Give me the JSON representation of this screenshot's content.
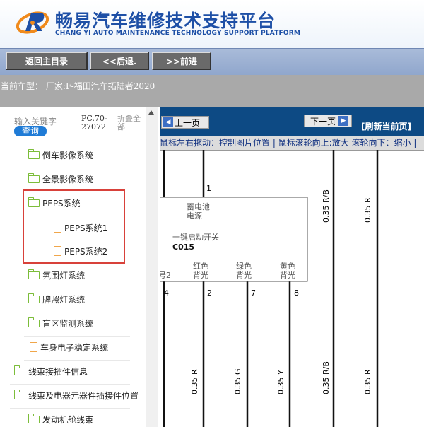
{
  "header": {
    "title_cn": "畅易汽车维修技术支持平台",
    "title_en": "CHANG YI AUTO MAINTENANCE TECHNOLOGY SUPPORT PLATFORM"
  },
  "nav": {
    "back_main": "返回主目录",
    "back": "<<后退.",
    "forward": ">>前进"
  },
  "vehicle": {
    "label": "当前车型：  厂家:F-福田汽车拓陆者2020"
  },
  "sidebar": {
    "search_placeholder": "输入关键字",
    "search_button": "查询",
    "code": "PC.70-27072",
    "collapse": "折叠全部",
    "items": [
      {
        "label": "倒车影像系统",
        "icon": "folder-icon"
      },
      {
        "label": "全景影像系统",
        "icon": "folder-icon"
      },
      {
        "label": "PEPS系统",
        "icon": "folder-open-icon"
      },
      {
        "label": "PEPS系统1",
        "icon": "file-icon"
      },
      {
        "label": "PEPS系统2",
        "icon": "file-icon"
      },
      {
        "label": "氛围灯系统",
        "icon": "folder-icon"
      },
      {
        "label": "牌照灯系统",
        "icon": "folder-icon"
      },
      {
        "label": "盲区监测系统",
        "icon": "folder-icon"
      },
      {
        "label": "车身电子稳定系统",
        "icon": "file-icon"
      },
      {
        "label": "线束接插件信息",
        "icon": "folder-icon"
      },
      {
        "label": "线束及电器元器件插接件位置",
        "icon": "folder-open-icon"
      },
      {
        "label": "发动机舱线束",
        "icon": "folder-icon"
      }
    ]
  },
  "viewer": {
    "prev_page": "上一页",
    "next_page": "下一页",
    "refresh": "[刷新当前页]",
    "hint": "鼠标左右拖动：控制图片位置 | 鼠标滚轮向上:放大  滚轮向下：缩小 |"
  },
  "diagram": {
    "pin_top": "1",
    "box_label1": "蓄电池",
    "box_label2": "电源",
    "box_label3": "一键启动开关",
    "box_code": "C015",
    "lbl_red1": "红色",
    "lbl_red2": "背光",
    "lbl_green1": "绿色",
    "lbl_green2": "背光",
    "lbl_yellow1": "黄色",
    "lbl_yellow2": "背光",
    "left_cut": "号2",
    "pins_bottom": [
      "4",
      "2",
      "7",
      "8"
    ],
    "wires_top": [
      "0.35 R/B",
      "0.35 R"
    ],
    "wires_bottom": [
      "0.35 R",
      "0.35 G",
      "0.35 Y",
      "0.35 R/B",
      "0.35 R"
    ]
  }
}
